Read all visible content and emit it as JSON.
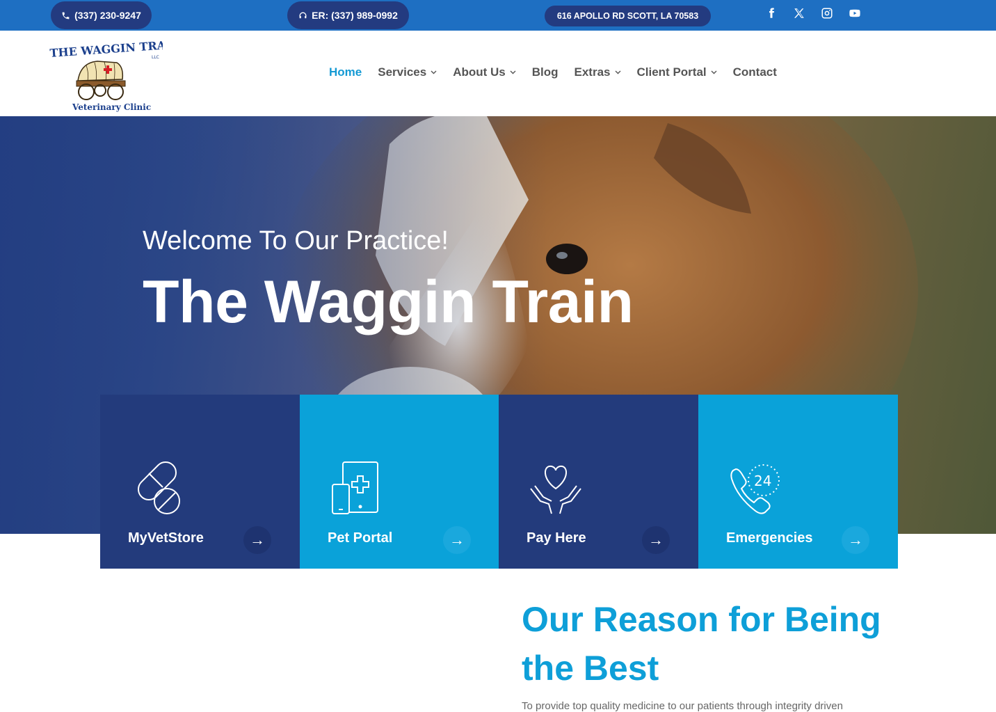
{
  "topbar": {
    "phone": "(337) 230-9247",
    "er_phone": "ER: (337) 989-0992",
    "address": "616 APOLLO RD SCOTT, LA 70583",
    "social": [
      "facebook-icon",
      "x-icon",
      "instagram-icon",
      "youtube-icon"
    ]
  },
  "logo": {
    "line1": "THE WAGGIN TRAIN",
    "llc": "LLC",
    "line2": "Veterinary Clinic"
  },
  "nav": {
    "items": [
      {
        "label": "Home",
        "active": true,
        "dropdown": false
      },
      {
        "label": "Services",
        "dropdown": true
      },
      {
        "label": "About Us",
        "dropdown": true
      },
      {
        "label": "Blog",
        "dropdown": false
      },
      {
        "label": "Extras",
        "dropdown": true
      },
      {
        "label": "Client Portal",
        "dropdown": true
      },
      {
        "label": "Contact",
        "dropdown": false
      }
    ]
  },
  "hero": {
    "subtitle": "Welcome To Our Practice!",
    "title": "The Waggin Train"
  },
  "cards": [
    {
      "label": "MyVetStore",
      "icon": "pills-icon",
      "style": "dark"
    },
    {
      "label": "Pet Portal",
      "icon": "tablet-medical-icon",
      "style": "light"
    },
    {
      "label": "Pay Here",
      "icon": "heart-hands-icon",
      "style": "dark"
    },
    {
      "label": "Emergencies",
      "icon": "phone-24-icon",
      "style": "light"
    }
  ],
  "arrow_glyph": "→",
  "reason": {
    "title": "Our Reason for Being the Best",
    "text": "To provide top quality medicine to our patients through integrity driven"
  },
  "colors": {
    "topbar": "#1e6fc2",
    "pill": "#233b80",
    "accent": "#0e9fd8",
    "card_dark": "#233b7c",
    "card_light": "#0aa2d9"
  }
}
